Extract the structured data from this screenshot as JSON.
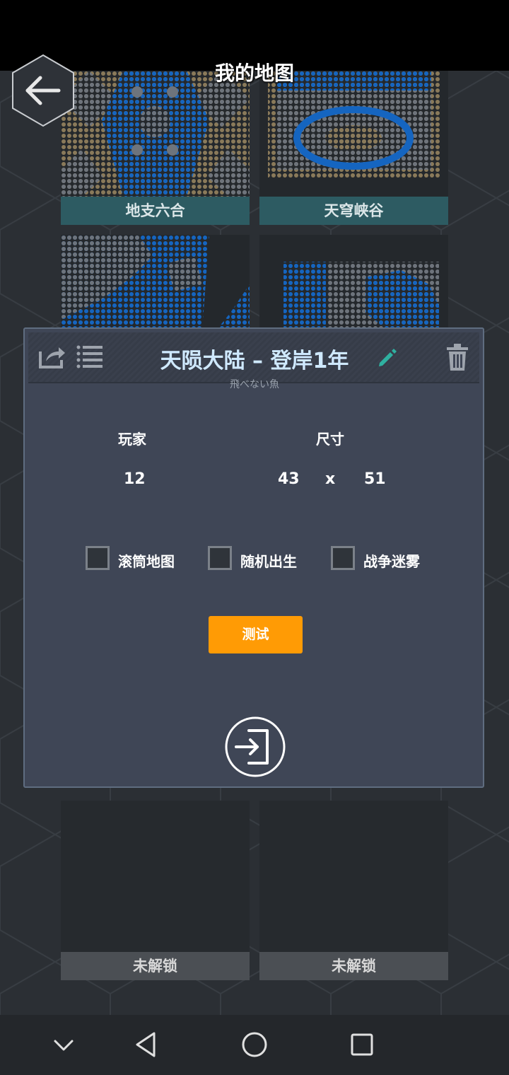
{
  "header": {
    "title": "我的地图"
  },
  "maps": [
    {
      "name": "地支六合",
      "locked": false
    },
    {
      "name": "天穹峡谷",
      "locked": false
    },
    {
      "name": "未解锁",
      "locked": true
    },
    {
      "name": "未解锁",
      "locked": true
    }
  ],
  "dialog": {
    "map_name": "天陨大陆 – 登岸1年",
    "author": "飛べない魚",
    "players_label": "玩家",
    "players_value": "12",
    "size_label": "尺寸",
    "size_width": "43",
    "size_sep": "x",
    "size_height": "51",
    "options": [
      {
        "label": "滚筒地图",
        "checked": false
      },
      {
        "label": "随机出生",
        "checked": false
      },
      {
        "label": "战争迷雾",
        "checked": false
      }
    ],
    "test_label": "测试"
  },
  "colors": {
    "accent": "#ff9b05",
    "title_blue": "#cfe9ff",
    "water": "#1565c0",
    "land": "#8a7a5a"
  },
  "icons": [
    "back-arrow-icon",
    "share-icon",
    "list-icon",
    "edit-pencil-icon",
    "trash-icon",
    "enter-icon",
    "nav-collapse-icon",
    "nav-back-icon",
    "nav-home-icon",
    "nav-recents-icon"
  ]
}
